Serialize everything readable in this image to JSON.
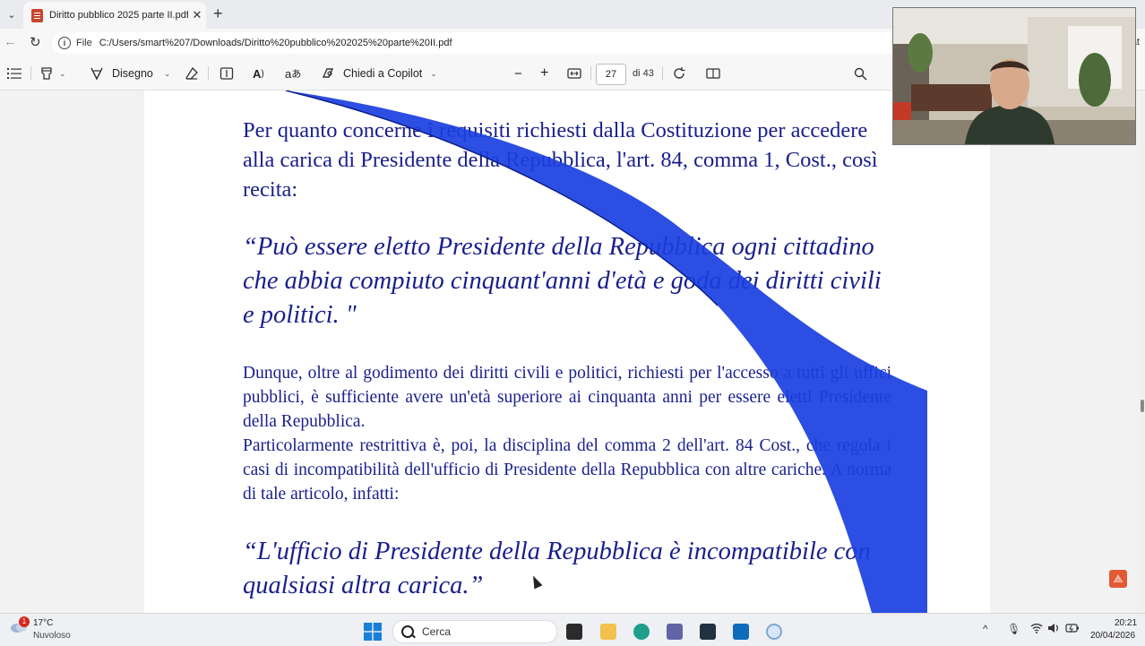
{
  "browser": {
    "tab": {
      "title": "Diritto pubblico 2025 parte II.pdf",
      "close": "✕"
    },
    "new_tab": "+",
    "address": {
      "scheme": "File",
      "url": "C:/Users/smart%207/Downloads/Diritto%20pubblico%202025%20parte%20II.pdf",
      "right_text": "at"
    }
  },
  "pdf_toolbar": {
    "draw_label": "Disegno",
    "copilot_label": "Chiedi a Copilot",
    "zoom_out": "−",
    "zoom_in": "+",
    "page_current": "27",
    "page_total": "di 43"
  },
  "document": {
    "paragraph_1": "Per quanto concerne i requisiti richiesti dalla Costituzione per accedere alla carica di Presidente della Repubblica, l'art. 84, comma 1, Cost., così recita:",
    "quote_1": "“Può essere eletto Presidente della Repubblica ogni cittadino che abbia compiuto cinquant'anni d'età e goda dei diritti civili e politici. \"",
    "paragraph_2": "Dunque, oltre al godimento dei diritti civili e politici, richiesti per l'accesso a tutti gli uffici pubblici, è sufficiente avere un'età superiore ai cinquanta anni per essere eletti Presidente della Repubblica.",
    "paragraph_3": "Particolarmente restrittiva è, poi, la disciplina del comma 2 dell'art. 84 Cost., che regola i casi di incompatibilità dell'ufficio di Presidente della Repubblica con altre cariche. A norma di tale articolo, infatti:",
    "quote_2": "“L'ufficio di Presidente della Repubblica è incompatibile con qualsiasi altra carica.”",
    "text_color": "#181f8c",
    "curl_color": "#1a3fe0"
  },
  "taskbar": {
    "weather_badge": "1",
    "weather_temp": "17°C",
    "weather_desc": "Nuvoloso",
    "search_label": "Cerca",
    "time": "20:21",
    "date": "20/04/2026"
  }
}
